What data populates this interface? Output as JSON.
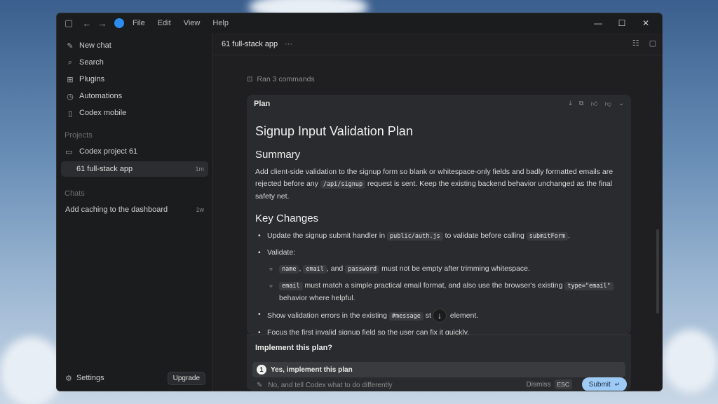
{
  "titlebar": {
    "menu": [
      "File",
      "Edit",
      "View",
      "Help"
    ]
  },
  "sidebar": {
    "nav": [
      {
        "label": "New chat",
        "icon": "edit-icon"
      },
      {
        "label": "Search",
        "icon": "search-icon"
      },
      {
        "label": "Plugins",
        "icon": "plugins-icon"
      },
      {
        "label": "Automations",
        "icon": "clock-icon"
      },
      {
        "label": "Codex mobile",
        "icon": "phone-icon"
      }
    ],
    "projects_label": "Projects",
    "project": {
      "label": "Codex project 61"
    },
    "project_thread": {
      "label": "61 full-stack app",
      "meta": "1m"
    },
    "chats_label": "Chats",
    "chat": {
      "label": "Add caching to the dashboard",
      "meta": "1w"
    },
    "settings_label": "Settings",
    "upgrade_label": "Upgrade"
  },
  "main": {
    "title": "61 full-stack app",
    "ran_commands": "Ran 3 commands",
    "plan": {
      "label": "Plan",
      "heading": "Signup Input Validation Plan",
      "summary_heading": "Summary",
      "summary": {
        "t1": "Add client-side validation to the signup form so blank or whitespace-only fields and badly formatted emails are rejected before any ",
        "code1": "/api/signup",
        "t2": " request is sent. Keep the existing backend behavior unchanged as the final safety net."
      },
      "changes_heading": "Key Changes",
      "b1": {
        "t1": "Update the signup submit handler in ",
        "c1": "public/auth.js",
        "t2": " to validate before calling ",
        "c2": "submitForm",
        "t3": "."
      },
      "b2": {
        "t1": "Validate:"
      },
      "b2a": {
        "c1": "name",
        "t1": ", ",
        "c2": "email",
        "t2": ", and ",
        "c3": "password",
        "t3": " must not be empty after trimming whitespace."
      },
      "b2b": {
        "c1": "email",
        "t1": " must match a simple practical email format, and also use the browser's existing ",
        "c2": "type=\"email\"",
        "t2": " behavior where helpful."
      },
      "b3": {
        "t1": "Show validation errors in the existing ",
        "c1": "#message",
        "t2": " st",
        "t3": " element."
      },
      "b4": {
        "t1": "Focus the first invalid signup field so the user can fix it quickly."
      }
    },
    "implement": {
      "title": "Implement this plan?",
      "option1_num": "1",
      "option1": "Yes, implement this plan",
      "option2_placeholder": "No, and tell Codex what to do differently",
      "dismiss": "Dismiss",
      "esc": "ESC",
      "submit": "Submit"
    }
  },
  "colors": {
    "accent": "#2d8cf0",
    "submit_bg": "#9ecbf5"
  }
}
